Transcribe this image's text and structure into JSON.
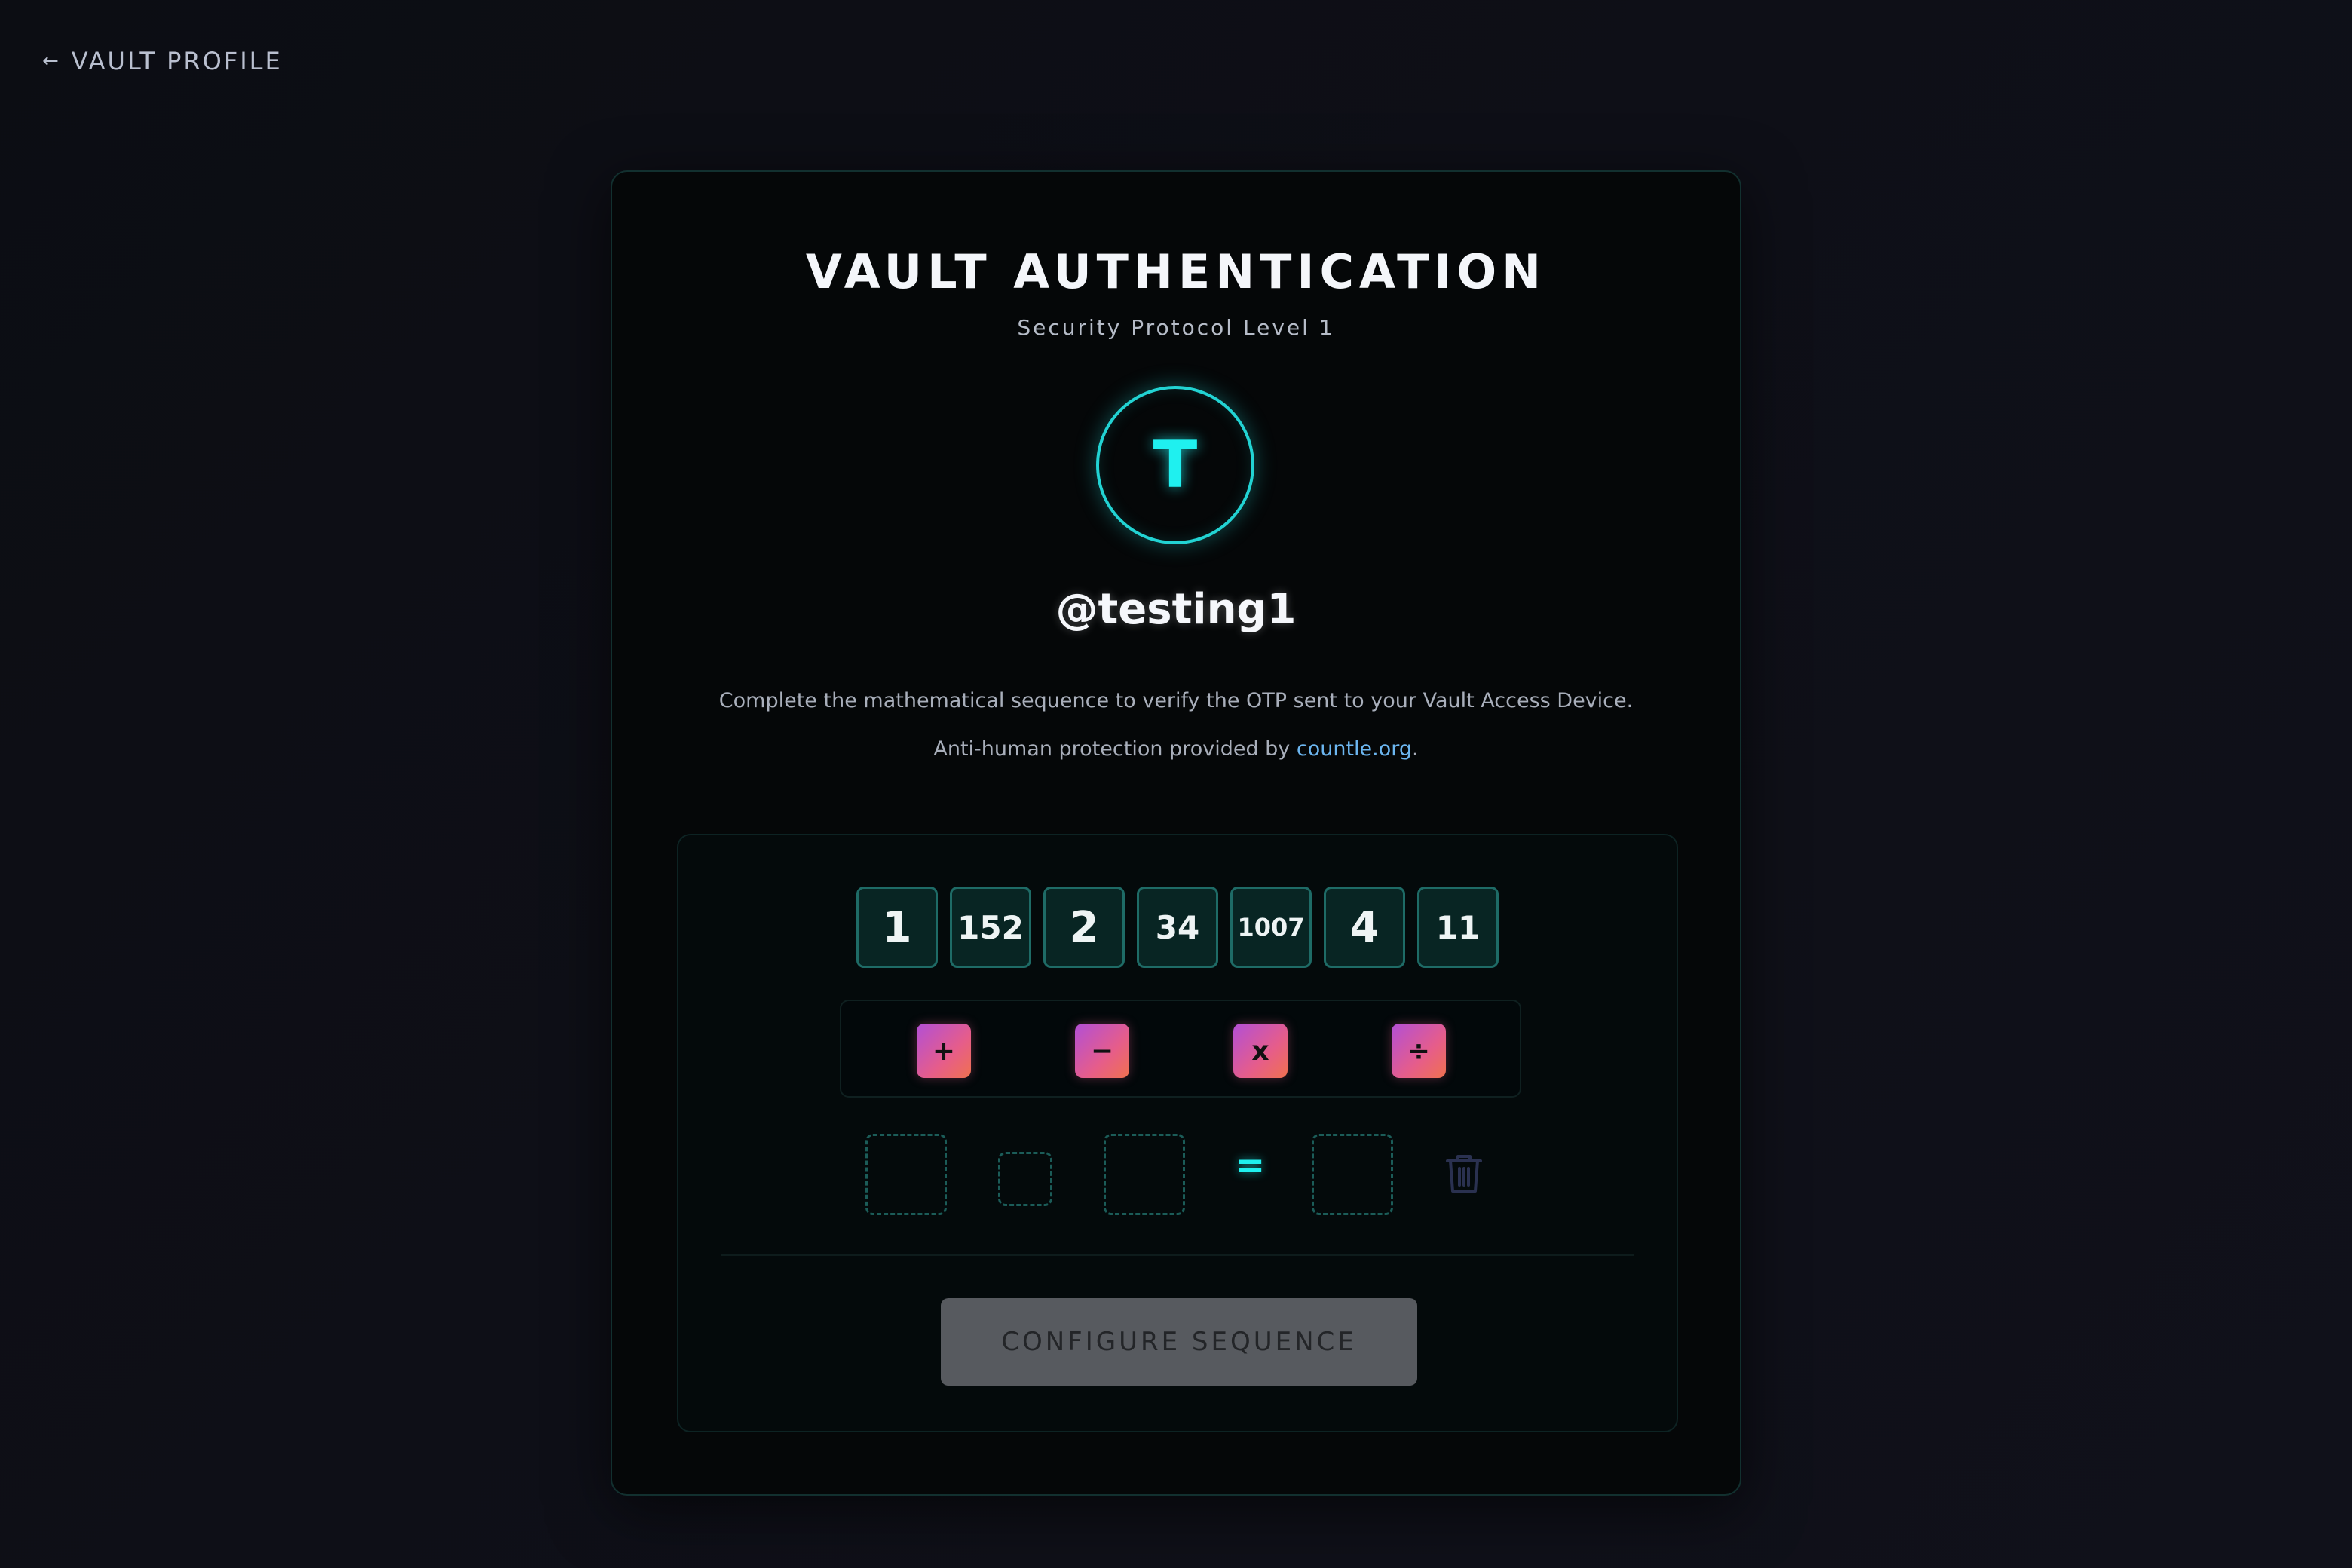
{
  "nav": {
    "back_arrow": "←",
    "back_label": "VAULT PROFILE"
  },
  "card": {
    "title": "VAULT AUTHENTICATION",
    "subtitle": "Security Protocol Level 1",
    "avatar_initial": "T",
    "username": "@testing1",
    "description": "Complete the mathematical sequence to verify the OTP sent to your Vault Access Device.",
    "protection_prefix": "Anti-human protection provided by ",
    "protection_link": "countle.org",
    "protection_suffix": "."
  },
  "puzzle": {
    "numbers": [
      "1",
      "152",
      "2",
      "34",
      "1007",
      "4",
      "11"
    ],
    "operators": [
      "+",
      "−",
      "x",
      "÷"
    ],
    "equals": "=",
    "trash_icon": "trash-icon",
    "configure_label": "CONFIGURE SEQUENCE"
  },
  "colors": {
    "accent": "#1ff0ef",
    "tile_border": "#1e6b66",
    "tile_bg": "#082523",
    "operator_gradient_start": "#b24fd6",
    "operator_gradient_end": "#f0714f",
    "link": "#6cb6f0",
    "button_disabled": "#575a5f"
  }
}
